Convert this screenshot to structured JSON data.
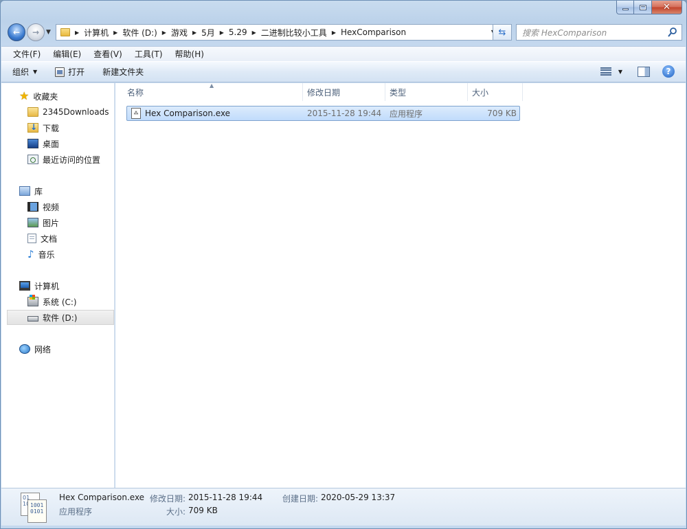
{
  "window": {
    "caption_buttons": {
      "minimize": "minimize",
      "maximize": "maximize",
      "close": "close"
    }
  },
  "address_bar": {
    "crumbs": [
      "计算机",
      "软件 (D:)",
      "游戏",
      "5月",
      "5.29",
      "二进制比较小工具",
      "HexComparison"
    ]
  },
  "search": {
    "placeholder": "搜索 HexComparison"
  },
  "menu": {
    "items": [
      "文件(F)",
      "编辑(E)",
      "查看(V)",
      "工具(T)",
      "帮助(H)"
    ]
  },
  "toolbar": {
    "organize": "组织",
    "open": "打开",
    "new_folder": "新建文件夹"
  },
  "nav_pane": {
    "favorites": "收藏夹",
    "fav_items": [
      "2345Downloads",
      "下载",
      "桌面",
      "最近访问的位置"
    ],
    "libraries": "库",
    "lib_items": [
      "视频",
      "图片",
      "文档",
      "音乐"
    ],
    "computer": "计算机",
    "drives": [
      "系统 (C:)",
      "软件 (D:)"
    ],
    "network": "网络"
  },
  "columns": {
    "name": "名称",
    "date": "修改日期",
    "type": "类型",
    "size": "大小"
  },
  "files": [
    {
      "name": "Hex Comparison.exe",
      "date": "2015-11-28 19:44",
      "type": "应用程序",
      "size": "709 KB"
    }
  ],
  "details": {
    "file_name": "Hex Comparison.exe",
    "modified_label": "修改日期:",
    "modified_value": "2015-11-28 19:44",
    "created_label": "创建日期:",
    "created_value": "2020-05-29 13:37",
    "type_value": "应用程序",
    "size_label": "大小:",
    "size_value": "709 KB"
  },
  "colors": {
    "selection": "#c1dcfc",
    "accent": "#2a6fc9"
  }
}
